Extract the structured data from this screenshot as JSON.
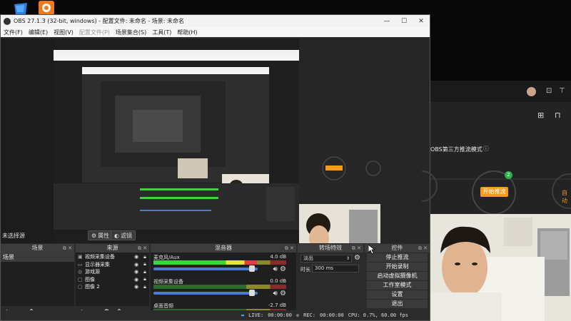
{
  "obs": {
    "title": "OBS 27.1.3 (32-bit, windows) - 配置文件: 未命名 - 场景: 未命名",
    "window_controls": [
      "—",
      "☐",
      "✕"
    ],
    "menu": [
      "文件(F)",
      "编辑(E)",
      "视图(V)",
      "配置文件(P)",
      "场景集合(S)",
      "工具(T)",
      "帮助(H)"
    ],
    "no_source": "未选择源",
    "properties_btn": "属性",
    "filters_btn": "滤镜",
    "docks": {
      "scenes": {
        "title": "场景",
        "items": [
          "场景"
        ]
      },
      "sources": {
        "title": "来源",
        "items": [
          "视频采集设备",
          "显示器采集",
          "游戏源",
          "图像",
          "图像 2"
        ]
      },
      "mixer": {
        "title": "混音器",
        "channels": [
          {
            "name": "麦克风/Aux",
            "db": "4.0 dB",
            "level": 0.78,
            "volume": 0.97
          },
          {
            "name": "视频采集设备",
            "db": "0.0 dB",
            "level": 0.0,
            "volume": 0.97
          },
          {
            "name": "桌面音频",
            "db": "-2.7 dB",
            "level": 0.0,
            "volume": 0.9
          }
        ]
      },
      "transitions": {
        "title": "转场特效",
        "selected": "淡出",
        "duration_label": "时长",
        "duration_value": "300 ms"
      },
      "controls": {
        "title": "控件",
        "buttons": [
          "停止推流",
          "开始录制",
          "启动虚拟摄像机",
          "工作室模式",
          "设置",
          "退出"
        ]
      }
    },
    "status": {
      "live_label": "LIVE:",
      "live_time": "00:00:00",
      "rec_label": "REC:",
      "rec_time": "00:00:00",
      "cpu": "CPU: 0.7%, 60.00 fps"
    }
  },
  "right_app": {
    "mode_label": "OBS第三方推流模式",
    "start_button": "开始推流",
    "auto_label": "自动",
    "badge": "2"
  },
  "colors": {
    "accent_orange": "#f29a1a",
    "obs_bg": "#2b2b2b",
    "meter_green": "#3fd43f",
    "slider_blue": "#4a7bd6"
  }
}
